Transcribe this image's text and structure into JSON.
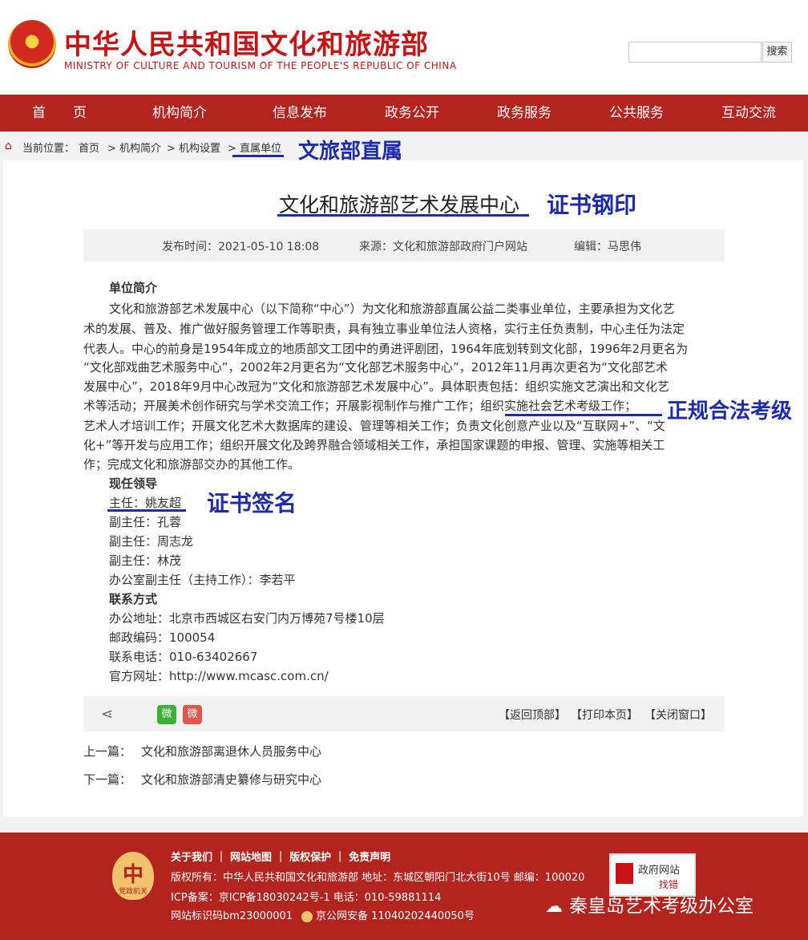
{
  "header": {
    "title_cn": "中华人民共和国文化和旅游部",
    "title_en": "MINISTRY OF CULTURE AND TOURISM OF THE PEOPLE'S REPUBLIC OF CHINA",
    "search_placeholder": "",
    "search_button": "搜索"
  },
  "nav": [
    "首　　页",
    "机构简介",
    "信息发布",
    "政务公开",
    "政务服务",
    "公共服务",
    "互动交流"
  ],
  "breadcrumb": {
    "prefix": "当前位置：",
    "items": [
      "首页",
      "> 机构简介",
      "> 机构设置",
      "> 直属单位"
    ]
  },
  "annotations": {
    "direct": "文旅部直属",
    "seal": "证书钢印",
    "legal": "正规合法考级",
    "signature": "证书签名"
  },
  "article": {
    "title": "文化和旅游部艺术发展中心",
    "meta": {
      "date": "发布时间：2021-05-10 18:08",
      "source": "来源：文化和旅游部政府门户网站",
      "editor": "编辑：马思伟"
    },
    "intro_heading": "单位简介",
    "intro_lines": [
      "文化和旅游部艺术发展中心（以下简称“中心”）为文化和旅游部直属公益二类事业单位，主要承担为文化艺",
      "术的发展、普及、推广做好服务管理工作等职责，具有独立事业单位法人资格，实行主任负责制，中心主任为法定",
      "代表人。中心的前身是1954年成立的地质部文工团中的勇进评剧团，1964年底划转到文化部，1996年2月更名为",
      "“文化部戏曲艺术服务中心”，2002年2月更名为“文化部艺术服务中心”，2012年11月再次更名为“文化部艺术",
      "发展中心”，2018年9月中心改冠为“文化和旅游部艺术发展中心”。具体职责包括：组织实施文艺演出和文化艺",
      "术等活动；开展美术创作研究与学术交流工作；开展影视制作与推广工作；组织实施社会艺术考级工作；",
      "艺术人才培训工作；开展文化艺术大数据库的建设、管理等相关工作；负责文化创意产业以及“互联网+”、“文",
      "化+”等开发与应用工作；组织开展文化及跨界融合领域相关工作，承担国家课题的申报、管理、实施等相关工",
      "作；完成文化和旅游部交办的其他工作。"
    ],
    "leaders_heading": "现任领导",
    "leaders": [
      "主任：姚友超",
      "副主任：孔蓉",
      "副主任：周志龙",
      "副主任：林茂",
      "办公室副主任（主持工作）：李若平"
    ],
    "contact_heading": "联系方式",
    "contacts": [
      "办公地址：北京市西城区右安门内万博苑7号楼10层",
      "邮政编码：100054",
      "联系电话：010-63402667",
      "官方网址：http://www.mcasc.com.cn/"
    ]
  },
  "share": {
    "wechat": "微",
    "weibo": "微",
    "links": [
      "【返回顶部】",
      "【打印本页】",
      "【关闭窗口】"
    ]
  },
  "pager": {
    "prev_label": "上一篇：",
    "prev_title": "文化和旅游部离退休人员服务中心",
    "next_label": "下一篇：",
    "next_title": "文化和旅游部清史纂修与研究中心"
  },
  "footer": {
    "links": "关于我们 ｜ 网站地图 ｜ 版权保护 ｜ 免责声明",
    "copyright": "版权所有：中华人民共和国文化和旅游部 地址：东城区朝阳门北大街10号 邮编：100020",
    "icp": "ICP备案：京ICP备18030242号-1 电话：010-59881114",
    "site_id": "网站标识码bm23000001",
    "police": "京公网安备 11040202440050号",
    "badge_mark": "中",
    "badge_label": "党政机关",
    "report_line1": "政府网站",
    "report_line2": "找错",
    "watermark": "秦皇岛艺术考级办公室"
  }
}
